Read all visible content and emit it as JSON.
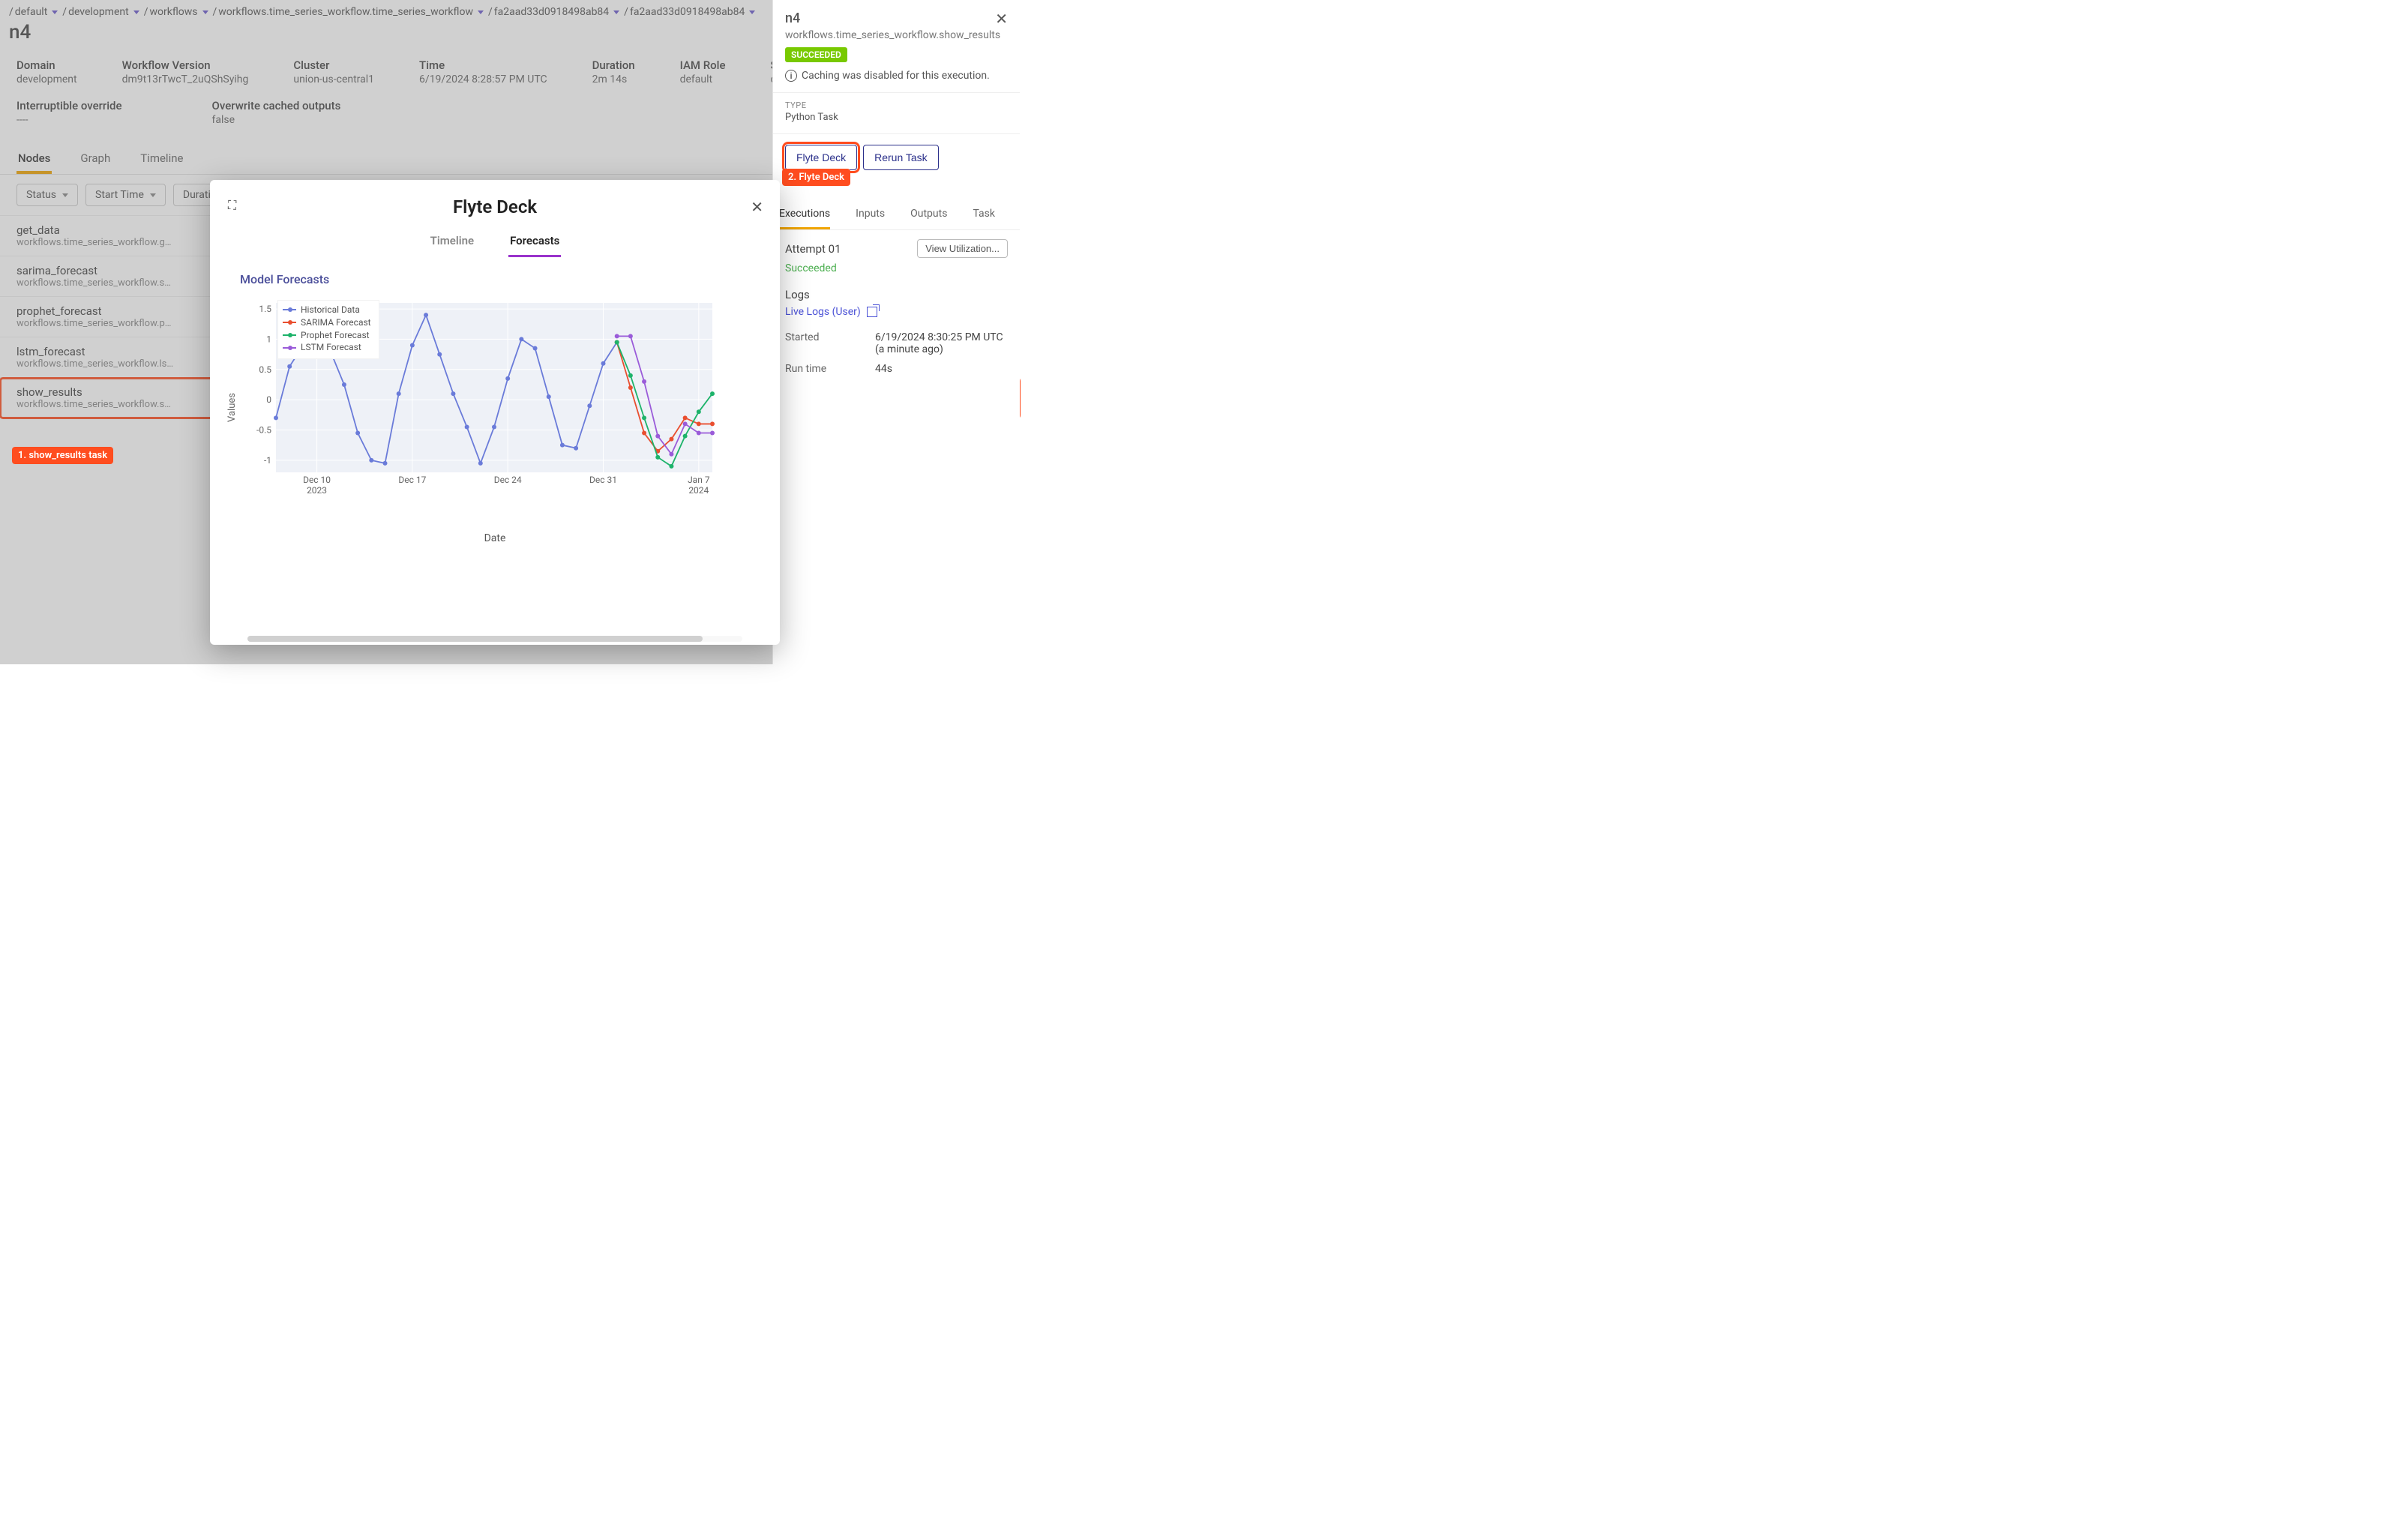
{
  "breadcrumb": {
    "items": [
      "default",
      "development",
      "workflows",
      "workflows.time_series_workflow.time_series_workflow",
      "fa2aad33d0918498ab84",
      "fa2aad33d0918498ab84"
    ]
  },
  "page_title": "n4",
  "meta": {
    "domain": {
      "label": "Domain",
      "value": "development"
    },
    "workflow_version": {
      "label": "Workflow Version",
      "value": "dm9t13rTwcT_2uQShSyihg"
    },
    "cluster": {
      "label": "Cluster",
      "value": "union-us-central1"
    },
    "time": {
      "label": "Time",
      "value": "6/19/2024 8:28:57 PM UTC"
    },
    "duration": {
      "label": "Duration",
      "value": "2m 14s"
    },
    "iam_role": {
      "label": "IAM Role",
      "value": "default"
    },
    "service_account": {
      "label": "Service Acc",
      "value": "default"
    },
    "interruptible": {
      "label": "Interruptible override",
      "value": "----"
    },
    "overwrite": {
      "label": "Overwrite cached outputs",
      "value": "false"
    }
  },
  "tabs": {
    "items": [
      {
        "label": "Nodes"
      },
      {
        "label": "Graph"
      },
      {
        "label": "Timeline"
      }
    ]
  },
  "filters": {
    "status": "Status",
    "start_time": "Start Time",
    "duration": "Durati"
  },
  "nodes": [
    {
      "name": "get_data",
      "path": "workflows.time_series_workflow.get_data",
      "id": "n0"
    },
    {
      "name": "sarima_forecast",
      "path": "workflows.time_series_workflow.sarima...",
      "id": "n1"
    },
    {
      "name": "prophet_forecast",
      "path": "workflows.time_series_workflow.prophet...",
      "id": "n2"
    },
    {
      "name": "lstm_forecast",
      "path": "workflows.time_series_workflow.lstm_fo...",
      "id": "n3"
    },
    {
      "name": "show_results",
      "path": "workflows.time_series_workflow.show_r...",
      "id": "n4"
    }
  ],
  "annotations": {
    "a1": "1. show_results task",
    "a2": "2. Flyte Deck"
  },
  "side": {
    "title": "n4",
    "sub": "workflows.time_series_workflow.show_results",
    "status": "SUCCEEDED",
    "cache": "Caching was disabled for this execution.",
    "type_label": "TYPE",
    "type_value": "Python Task",
    "flyte_deck_btn": "Flyte Deck",
    "rerun_btn": "Rerun Task",
    "tabs": [
      {
        "label": "Executions"
      },
      {
        "label": "Inputs"
      },
      {
        "label": "Outputs"
      },
      {
        "label": "Task"
      }
    ],
    "attempt": "Attempt 01",
    "view_util": "View Utilization...",
    "succeeded_text": "Succeeded",
    "logs_label": "Logs",
    "logs_link": "Live Logs (User)",
    "started_label": "Started",
    "started_value": "6/19/2024 8:30:25 PM UTC (a minute ago)",
    "run_label": "Run time",
    "run_value": "44s"
  },
  "modal": {
    "title": "Flyte Deck",
    "tabs": [
      {
        "label": "Timeline"
      },
      {
        "label": "Forecasts"
      }
    ],
    "chart_title": "Model Forecasts",
    "xlabel": "Date",
    "ylabel": "Values",
    "legend": [
      "Historical Data",
      "SARIMA Forecast",
      "Prophet Forecast",
      "LSTM Forecast"
    ],
    "xticks": [
      {
        "l1": "Dec 10",
        "l2": "2023"
      },
      {
        "l1": "Dec 17",
        "l2": ""
      },
      {
        "l1": "Dec 24",
        "l2": ""
      },
      {
        "l1": "Dec 31",
        "l2": ""
      },
      {
        "l1": "Jan 7",
        "l2": "2024"
      }
    ]
  },
  "chart_data": {
    "type": "line",
    "title": "Model Forecasts",
    "xlabel": "Date",
    "ylabel": "Values",
    "ylim": [
      -1.2,
      1.6
    ],
    "yticks": [
      -1,
      -0.5,
      0,
      0.5,
      1,
      1.5
    ],
    "x": [
      "2023-12-07",
      "2023-12-08",
      "2023-12-09",
      "2023-12-10",
      "2023-12-11",
      "2023-12-12",
      "2023-12-13",
      "2023-12-14",
      "2023-12-15",
      "2023-12-16",
      "2023-12-17",
      "2023-12-18",
      "2023-12-19",
      "2023-12-20",
      "2023-12-21",
      "2023-12-22",
      "2023-12-23",
      "2023-12-24",
      "2023-12-25",
      "2023-12-26",
      "2023-12-27",
      "2023-12-28",
      "2023-12-29",
      "2023-12-30",
      "2023-12-31",
      "2024-01-01"
    ],
    "series": [
      {
        "name": "Historical Data",
        "color": "#6a7bd9",
        "values": [
          -0.3,
          0.55,
          0.9,
          0.8,
          0.8,
          0.25,
          -0.55,
          -1.0,
          -1.05,
          0.1,
          0.9,
          1.4,
          0.75,
          0.1,
          -0.45,
          -1.05,
          -0.45,
          0.35,
          1.0,
          0.85,
          0.05,
          -0.75,
          -0.8,
          -0.1,
          0.6,
          0.95
        ]
      },
      {
        "name": "SARIMA Forecast",
        "color": "#e94e2f",
        "x": [
          "2024-01-01",
          "2024-01-02",
          "2024-01-03",
          "2024-01-04",
          "2024-01-05",
          "2024-01-06",
          "2024-01-07",
          "2024-01-08"
        ],
        "values": [
          0.95,
          0.2,
          -0.55,
          -0.85,
          -0.65,
          -0.3,
          -0.4,
          -0.4
        ]
      },
      {
        "name": "Prophet Forecast",
        "color": "#1db36a",
        "x": [
          "2024-01-01",
          "2024-01-02",
          "2024-01-03",
          "2024-01-04",
          "2024-01-05",
          "2024-01-06",
          "2024-01-07",
          "2024-01-08"
        ],
        "values": [
          0.95,
          0.4,
          -0.3,
          -0.95,
          -1.1,
          -0.6,
          -0.2,
          0.1
        ]
      },
      {
        "name": "LSTM Forecast",
        "color": "#9a5bd9",
        "x": [
          "2024-01-01",
          "2024-01-02",
          "2024-01-03",
          "2024-01-04",
          "2024-01-05",
          "2024-01-06",
          "2024-01-07",
          "2024-01-08"
        ],
        "values": [
          1.05,
          1.05,
          0.3,
          -0.6,
          -0.9,
          -0.4,
          -0.55,
          -0.55
        ]
      }
    ]
  }
}
